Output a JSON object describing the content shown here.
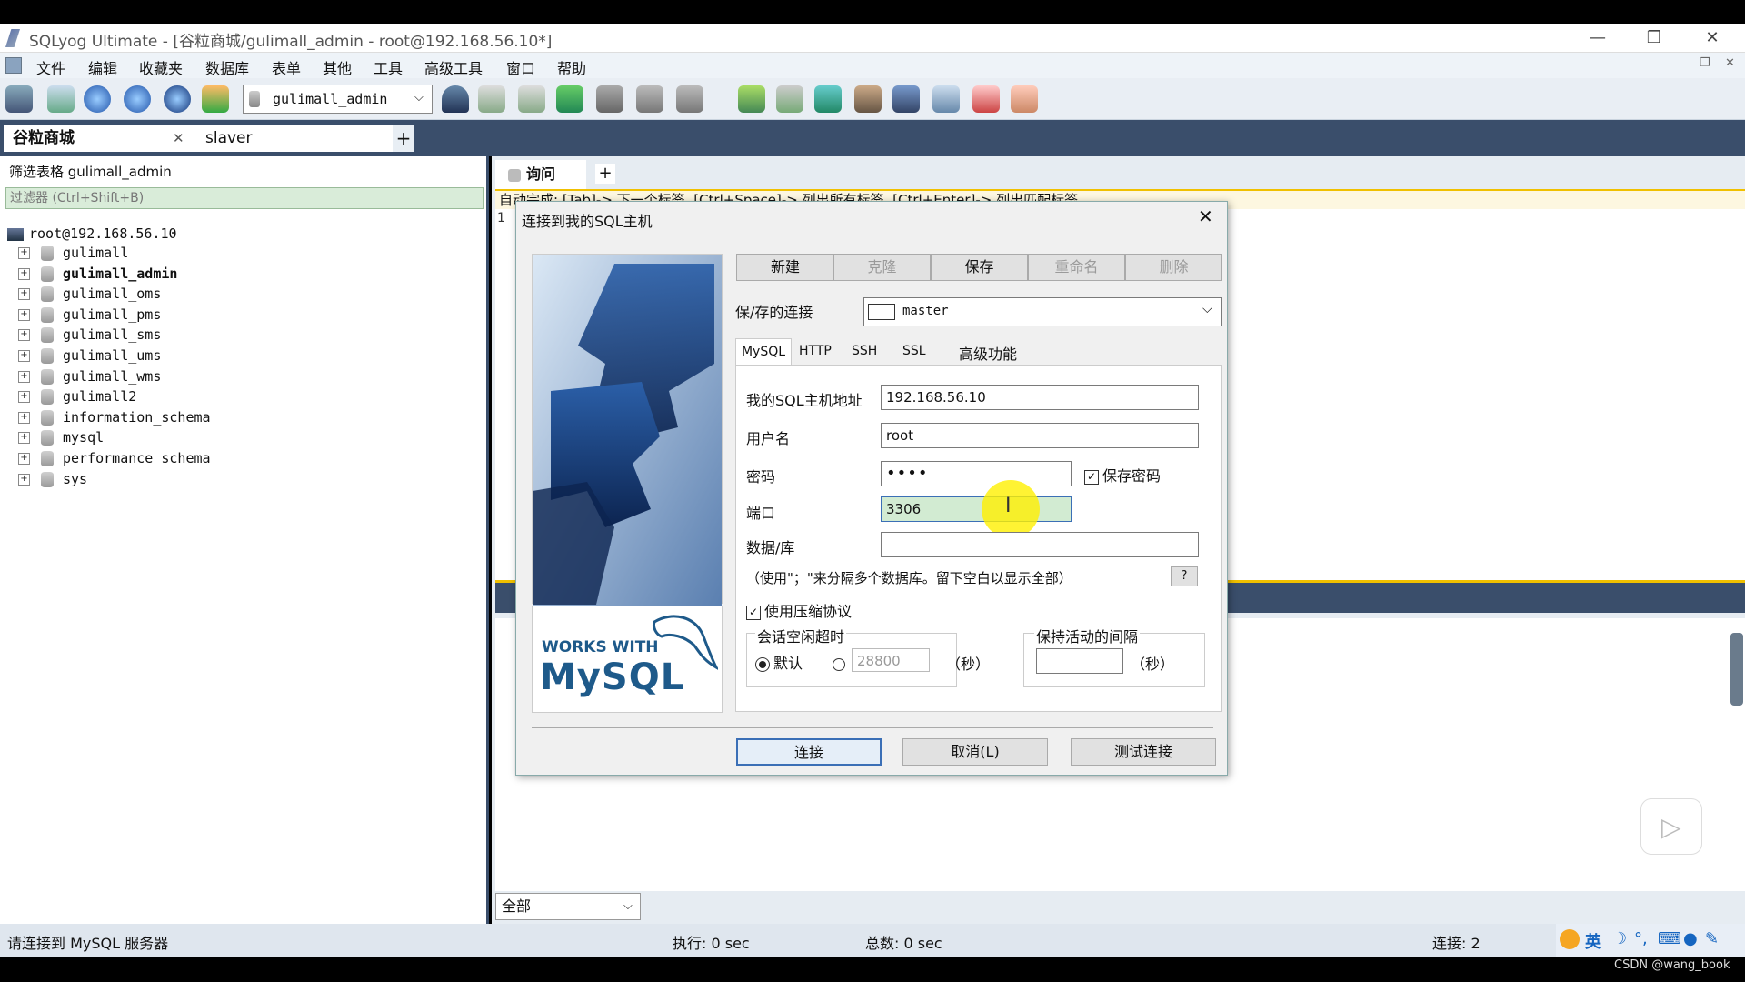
{
  "window": {
    "title": "SQLyog Ultimate - [谷粒商城/gulimall_admin - root@192.168.56.10*]",
    "minimize": "—",
    "restore": "❐",
    "close": "✕"
  },
  "menu": [
    "文件",
    "编辑",
    "收藏夹",
    "数据库",
    "表单",
    "其他",
    "工具",
    "高级工具",
    "窗口",
    "帮助"
  ],
  "toolbar": {
    "db_select": "gulimall_admin"
  },
  "conn_tabs": [
    {
      "label": "谷粒商城",
      "close": "✕"
    },
    {
      "label": "slaver"
    }
  ],
  "conn_tab_add": "+",
  "left": {
    "filter_label": "筛选表格 gulimall_admin",
    "filter_placeholder": "过滤器 (Ctrl+Shift+B)",
    "root": "root@192.168.56.10",
    "databases": [
      "gulimall",
      "gulimall_admin",
      "gulimall_oms",
      "gulimall_pms",
      "gulimall_sms",
      "gulimall_ums",
      "gulimall_wms",
      "gulimall2",
      "information_schema",
      "mysql",
      "performance_schema",
      "sys"
    ],
    "selected_db": "gulimall_admin"
  },
  "query": {
    "tab_label": "询问",
    "tab_add": "+",
    "hint": "自动完成: [Tab]-> 下一个标签, [Ctrl+Space]-> 列出所有标签, [Ctrl+Enter]-> 列出匹配标签",
    "line_no": "1"
  },
  "result": {
    "filter_select": "全部"
  },
  "status": {
    "message": "请连接到 MySQL 服务器",
    "exec": "执行: 0 sec",
    "total": "总数: 0 sec",
    "conn": "连接: 2"
  },
  "ime": {
    "lang": "英"
  },
  "watermark": "CSDN @wang_book",
  "dialog": {
    "title": "连接到我的SQL主机",
    "close": "✕",
    "buttons": {
      "new": "新建",
      "clone": "克隆",
      "save": "保存",
      "rename": "重命名",
      "delete": "删除"
    },
    "saved_label": "保/存的连接",
    "saved_value": "master",
    "tabs": [
      "MySQL",
      "HTTP",
      "SSH",
      "SSL",
      "高级功能"
    ],
    "host_label": "我的SQL主机地址",
    "host_value": "192.168.56.10",
    "user_label": "用户名",
    "user_value": "root",
    "password_label": "密码",
    "password_value": "••••",
    "save_password": "保存密码",
    "port_label": "端口",
    "port_value": "3306",
    "db_label": "数据/库",
    "db_value": "",
    "db_hint": "（使用\"；\"来分隔多个数据库。留下空白以显示全部）",
    "help": "?",
    "compress": "使用压缩协议",
    "session_timeout": "会话空闲超时",
    "default": "默认",
    "timeout_value": "28800",
    "seconds": "（秒）",
    "keepalive": "保持活动的间隔",
    "keepalive_value": "",
    "connect": "连接",
    "cancel": "取消(L)",
    "test": "测试连接",
    "logo_top": "WORKS WITH",
    "logo_main": "MySQL"
  }
}
